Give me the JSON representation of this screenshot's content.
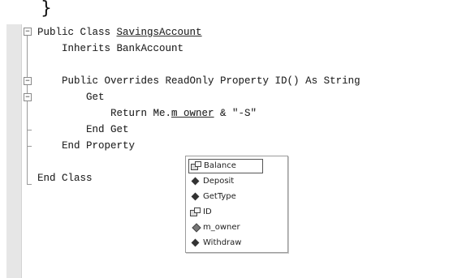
{
  "page": {
    "stray_brace": "}"
  },
  "code_editor": {
    "lines": [
      {
        "indent": "",
        "pre": "Public Class ",
        "underlined": "SavingsAccount",
        "post": ""
      },
      {
        "indent": "    ",
        "pre": "Inherits BankAccount",
        "underlined": "",
        "post": ""
      },
      {
        "indent": "",
        "pre": "",
        "underlined": "",
        "post": ""
      },
      {
        "indent": "    ",
        "pre": "Public Overrides ReadOnly Property ID() As String",
        "underlined": "",
        "post": ""
      },
      {
        "indent": "        ",
        "pre": "Get",
        "underlined": "",
        "post": ""
      },
      {
        "indent": "            ",
        "pre": "Return Me.",
        "underlined": "m_owner",
        "post": " & \"-S\""
      },
      {
        "indent": "        ",
        "pre": "End Get",
        "underlined": "",
        "post": ""
      },
      {
        "indent": "    ",
        "pre": "End Property",
        "underlined": "",
        "post": ""
      },
      {
        "indent": "",
        "pre": "",
        "underlined": "",
        "post": ""
      },
      {
        "indent": "",
        "pre": "End Class",
        "underlined": "",
        "post": ""
      }
    ],
    "outline_markers": {
      "collapse_symbol": "−"
    }
  },
  "intellisense": {
    "items": [
      {
        "label": "Balance",
        "icon": "property-icon",
        "selected": true
      },
      {
        "label": "Deposit",
        "icon": "method-icon",
        "selected": false
      },
      {
        "label": "GetType",
        "icon": "method-icon",
        "selected": false
      },
      {
        "label": "ID",
        "icon": "property-icon",
        "selected": false
      },
      {
        "label": "m_owner",
        "icon": "field-icon",
        "selected": false
      },
      {
        "label": "Withdraw",
        "icon": "method-icon",
        "selected": false
      }
    ]
  }
}
